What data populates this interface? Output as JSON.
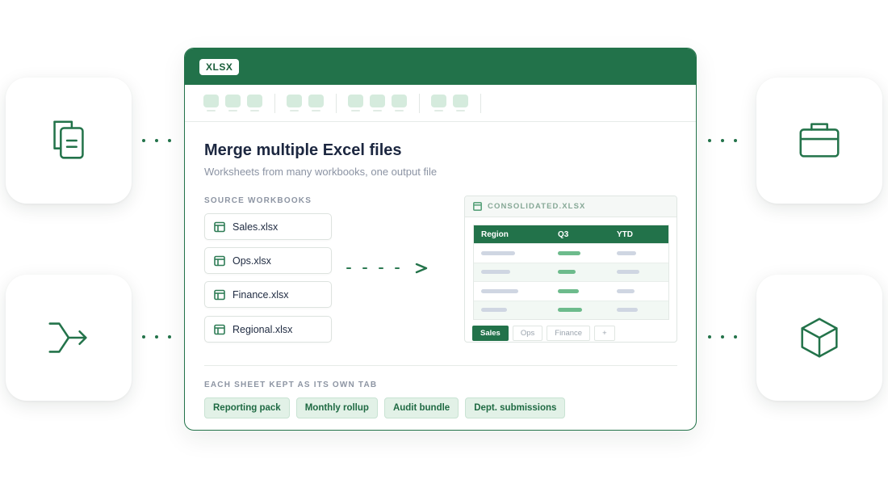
{
  "colors": {
    "brand": "#22724a",
    "accent_light": "#e2f1e7",
    "text": "#1c2740",
    "muted": "#8b93a3"
  },
  "side_tiles": [
    {
      "icon": "copy-document-icon"
    },
    {
      "icon": "merge-arrow-icon"
    },
    {
      "icon": "briefcase-icon"
    },
    {
      "icon": "cube-icon"
    }
  ],
  "card": {
    "badge": "XLSX",
    "title": "Merge multiple Excel files",
    "subtitle": "Worksheets from many workbooks, one output file",
    "source_label": "SOURCE WORKBOOKS",
    "files": [
      "Sales.xlsx",
      "Ops.xlsx",
      "Finance.xlsx",
      "Regional.xlsx"
    ],
    "preview": {
      "filename": "CONSOLIDATED.XLSX",
      "columns": [
        "Region",
        "Q3",
        "YTD"
      ],
      "sheet_tabs": [
        "Sales",
        "Ops",
        "Finance",
        "+"
      ],
      "active_tab": "Sales"
    },
    "tabs_label": "EACH SHEET KEPT AS ITS OWN TAB",
    "chips": [
      "Reporting pack",
      "Monthly rollup",
      "Audit bundle",
      "Dept. submissions"
    ]
  }
}
